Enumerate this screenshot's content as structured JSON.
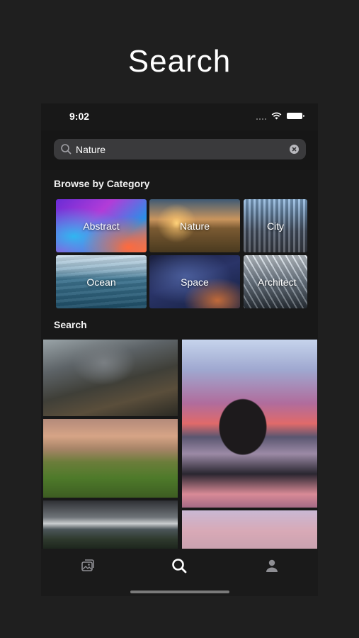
{
  "promo": {
    "title": "Search"
  },
  "status_bar": {
    "time": "9:02"
  },
  "search": {
    "value": "Nature"
  },
  "browse": {
    "title": "Browse by Category",
    "categories": [
      {
        "label": "Abstract"
      },
      {
        "label": "Nature"
      },
      {
        "label": "City"
      },
      {
        "label": "Ocean"
      },
      {
        "label": "Space"
      },
      {
        "label": "Architect"
      }
    ]
  },
  "results": {
    "title": "Search"
  },
  "tab_bar": {
    "tabs": [
      {
        "icon": "gallery-icon",
        "active": false
      },
      {
        "icon": "search-icon",
        "active": true
      },
      {
        "icon": "profile-icon",
        "active": false
      }
    ]
  },
  "colors": {
    "background": "#1f1f1f",
    "screen": "#181818",
    "search_field": "#3a3a3c",
    "active_tab": "#ffffff",
    "inactive_tab": "#8e8e93"
  }
}
